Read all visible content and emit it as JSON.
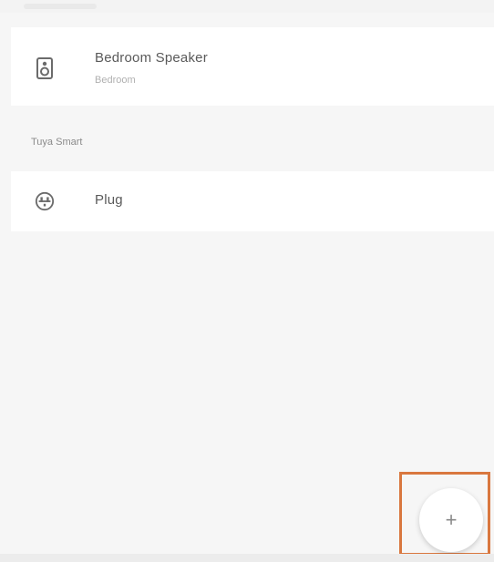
{
  "devices": [
    {
      "title": "Bedroom Speaker",
      "subtitle": "Bedroom",
      "icon": "speaker-icon"
    },
    {
      "title": "Plug",
      "icon": "plug-icon"
    }
  ],
  "section": {
    "label": "Tuya Smart"
  },
  "fab": {
    "label": "+",
    "icon": "plus-icon"
  },
  "colors": {
    "background": "#f6f6f6",
    "card": "#ffffff",
    "text_primary": "#5a5a5a",
    "text_secondary": "#b0b0b0",
    "highlight": "#d9773f"
  }
}
